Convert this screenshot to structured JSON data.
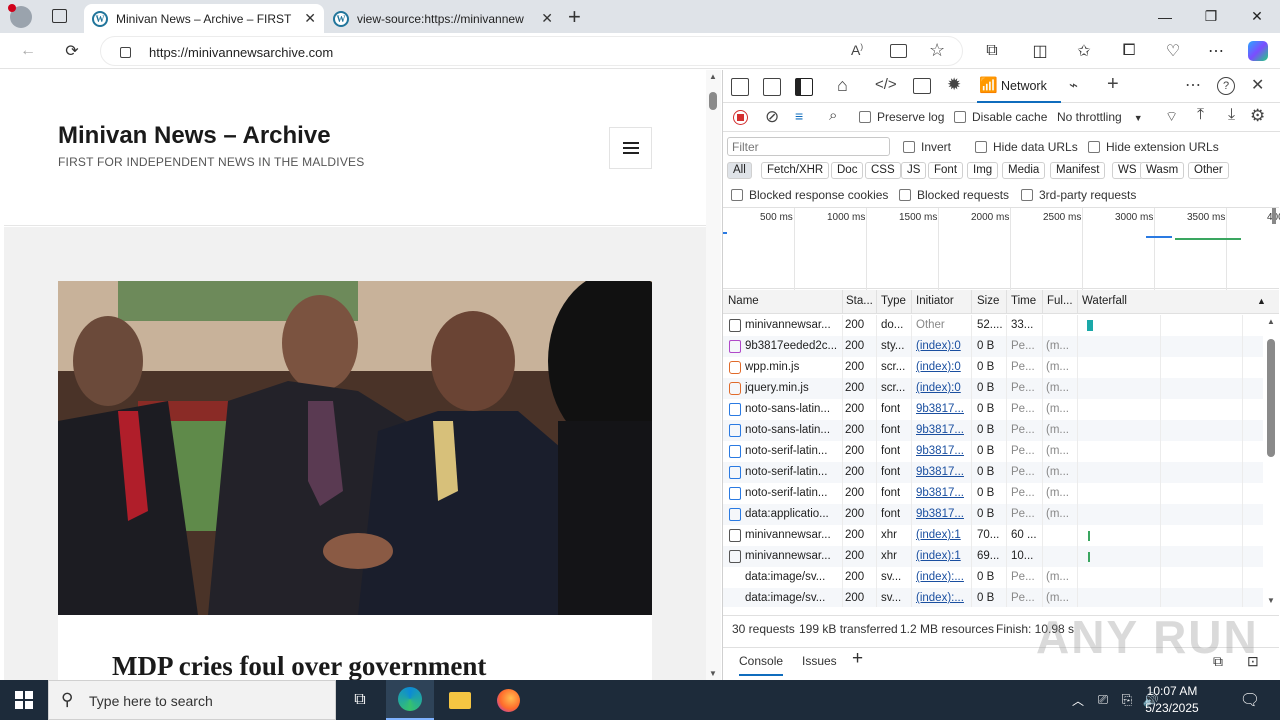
{
  "browser": {
    "tabs": [
      {
        "title": "Minivan News – Archive – FIRST F",
        "icon": "wordpress-icon"
      },
      {
        "title": "view-source:https://minivannew",
        "icon": "wordpress-icon"
      }
    ],
    "url": "https://minivannewsarchive.com"
  },
  "site": {
    "title": "Minivan News – Archive",
    "tagline": "FIRST FOR INDEPENDENT NEWS IN THE MALDIVES",
    "article_title": "MDP cries foul over government"
  },
  "devtools": {
    "active_panel": "Network",
    "toolbar": {
      "preserve_log": "Preserve log",
      "disable_cache": "Disable cache",
      "throttling": "No throttling"
    },
    "filter": {
      "placeholder": "Filter",
      "invert": "Invert",
      "hide_data_urls": "Hide data URLs",
      "hide_extension_urls": "Hide extension URLs"
    },
    "type_filters": [
      "All",
      "Fetch/XHR",
      "Doc",
      "CSS",
      "JS",
      "Font",
      "Img",
      "Media",
      "Manifest",
      "WS",
      "Wasm",
      "Other"
    ],
    "block_filters": [
      "Blocked response cookies",
      "Blocked requests",
      "3rd-party requests"
    ],
    "timeline_ticks": [
      "500 ms",
      "1000 ms",
      "1500 ms",
      "2000 ms",
      "2500 ms",
      "3000 ms",
      "3500 ms",
      "400"
    ],
    "columns": [
      "Name",
      "Sta...",
      "Type",
      "Initiator",
      "Size",
      "Time",
      "Ful...",
      "Waterfall"
    ],
    "rows": [
      {
        "name": "minivannewsar...",
        "status": "200",
        "type": "do...",
        "initiator": "Other",
        "size": "52....",
        "time": "33...",
        "full": "",
        "icon": "doc",
        "initiator_link": false
      },
      {
        "name": "9b3817eeded2c...",
        "status": "200",
        "type": "sty...",
        "initiator": "(index):0",
        "size": "0 B",
        "time": "Pe...",
        "full": "(m...",
        "icon": "css",
        "initiator_link": true
      },
      {
        "name": "wpp.min.js",
        "status": "200",
        "type": "scr...",
        "initiator": "(index):0",
        "size": "0 B",
        "time": "Pe...",
        "full": "(m...",
        "icon": "js",
        "initiator_link": true
      },
      {
        "name": "jquery.min.js",
        "status": "200",
        "type": "scr...",
        "initiator": "(index):0",
        "size": "0 B",
        "time": "Pe...",
        "full": "(m...",
        "icon": "js",
        "initiator_link": true
      },
      {
        "name": "noto-sans-latin...",
        "status": "200",
        "type": "font",
        "initiator": "9b3817...",
        "size": "0 B",
        "time": "Pe...",
        "full": "(m...",
        "icon": "font",
        "initiator_link": true
      },
      {
        "name": "noto-sans-latin...",
        "status": "200",
        "type": "font",
        "initiator": "9b3817...",
        "size": "0 B",
        "time": "Pe...",
        "full": "(m...",
        "icon": "font",
        "initiator_link": true
      },
      {
        "name": "noto-serif-latin...",
        "status": "200",
        "type": "font",
        "initiator": "9b3817...",
        "size": "0 B",
        "time": "Pe...",
        "full": "(m...",
        "icon": "font",
        "initiator_link": true
      },
      {
        "name": "noto-serif-latin...",
        "status": "200",
        "type": "font",
        "initiator": "9b3817...",
        "size": "0 B",
        "time": "Pe...",
        "full": "(m...",
        "icon": "font",
        "initiator_link": true
      },
      {
        "name": "noto-serif-latin...",
        "status": "200",
        "type": "font",
        "initiator": "9b3817...",
        "size": "0 B",
        "time": "Pe...",
        "full": "(m...",
        "icon": "font",
        "initiator_link": true
      },
      {
        "name": "data:applicatio...",
        "status": "200",
        "type": "font",
        "initiator": "9b3817...",
        "size": "0 B",
        "time": "Pe...",
        "full": "(m...",
        "icon": "font",
        "initiator_link": true
      },
      {
        "name": "minivannewsar...",
        "status": "200",
        "type": "xhr",
        "initiator": "(index):1",
        "size": "70...",
        "time": "60 ...",
        "full": "",
        "icon": "doc",
        "initiator_link": true
      },
      {
        "name": "minivannewsar...",
        "status": "200",
        "type": "xhr",
        "initiator": "(index):1",
        "size": "69...",
        "time": "10...",
        "full": "",
        "icon": "doc",
        "initiator_link": true
      },
      {
        "name": "data:image/sv...",
        "status": "200",
        "type": "sv...",
        "initiator": "(index):...",
        "size": "0 B",
        "time": "Pe...",
        "full": "(m...",
        "icon": "none",
        "initiator_link": true
      },
      {
        "name": "data:image/sv...",
        "status": "200",
        "type": "sv...",
        "initiator": "(index):...",
        "size": "0 B",
        "time": "Pe...",
        "full": "(m...",
        "icon": "none",
        "initiator_link": true
      }
    ],
    "summary": {
      "requests": "30 requests",
      "transferred": "199 kB transferred",
      "resources": "1.2 MB resources",
      "finish": "Finish: 10.98 s"
    },
    "drawer_tabs": [
      "Console",
      "Issues"
    ]
  },
  "taskbar": {
    "search_placeholder": "Type here to search",
    "time": "10:07 AM",
    "date": "5/23/2025"
  },
  "watermark": "ANY RUN"
}
